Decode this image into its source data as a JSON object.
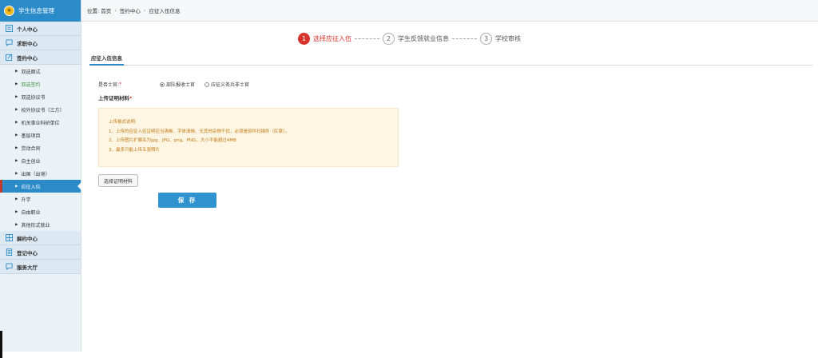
{
  "sidebar": {
    "brand": {
      "title": "学生信息管理"
    },
    "groups": [
      {
        "label": "个人中心",
        "icon": "person-icon"
      },
      {
        "label": "求职中心",
        "icon": "chat-icon"
      },
      {
        "label": "签约中心",
        "icon": "sign-icon"
      }
    ],
    "sub_items": [
      "双选面试",
      "双选签约",
      "双选协议书",
      "校外协议书（三方）",
      "机关事业科研单位",
      "基层项目",
      "劳动合同",
      "自主创业",
      "出国（出境）",
      "应征入伍",
      "升学",
      "自由职业",
      "其他形式就业"
    ],
    "bottom_groups": [
      {
        "label": "解约中心",
        "icon": "grid-icon"
      },
      {
        "label": "登记中心",
        "icon": "doc-icon"
      },
      {
        "label": "服务大厅",
        "icon": "chat-icon"
      }
    ]
  },
  "breadcrumb": {
    "prefix": "位置:",
    "home": "首页",
    "level2": "签约中心",
    "current": "应征入伍信息",
    "separator": "›"
  },
  "stepper": {
    "steps": [
      {
        "num": "1",
        "label": "选择应征入伍"
      },
      {
        "num": "2",
        "label": "学生反馈就业信息"
      },
      {
        "num": "3",
        "label": "学校审核"
      }
    ]
  },
  "tab": {
    "label": "应征入伍信息"
  },
  "form": {
    "question_label": "是否士官:",
    "required_mark": "*",
    "option1": "部队报收士官",
    "option2": "应征义务兵非士官",
    "upload_title": "上传证明材料",
    "notice": {
      "title": "上传格式说明:",
      "line1": "1、上传的应征入伍证明应当清晰、字体清晰、无其他杂物干扰，必须是原件扫描件（红章）。",
      "line2": "2、上传图片扩展名为jpg、JPG、png、PNG，大小不能超过4MB",
      "line3": "3、最多只能上传五张照片"
    },
    "choose_button": "选择证明材料",
    "save_button": "保 存"
  },
  "colors": {
    "brand_blue": "#2b8bc9",
    "active_red": "#d9342b",
    "notice_bg": "#fff5e3",
    "notice_text": "#c07a14"
  }
}
